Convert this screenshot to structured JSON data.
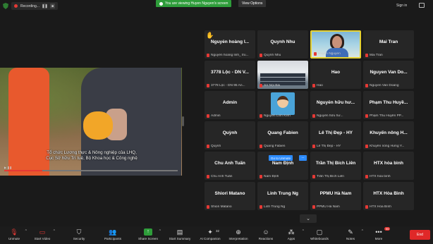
{
  "topbar": {
    "recording_label": "Recording...",
    "viewing_label": "You are viewing Huyen Nguyen's screen",
    "view_options_label": "View Options",
    "signin_label": "Sign in"
  },
  "share": {
    "subtitle_line1": "Tổ chức Lương thực & Nông nghiệp của LHQ,",
    "subtitle_line2": "Cục Sở hữu Trí tuệ, Bộ Khoa học & Công nghệ",
    "progress_fraction": 0.22
  },
  "participants": [
    {
      "name": "Nguyễn hoàng l...",
      "label": "Nguyễn hoàng linh_ tru...",
      "hand": true
    },
    {
      "name": "Quynh Nhu",
      "label": "Quỳnh Nhu"
    },
    {
      "name": "",
      "label": "Huyen Nguyen",
      "picture": "speaker",
      "active": true
    },
    {
      "name": "Mai Tran",
      "label": "Mai Tran"
    },
    {
      "name": "3778 Lộc - DN V...",
      "label": "3778 Lộc - DN 95 An..."
    },
    {
      "name": "",
      "label": "Sở Nội Bài",
      "picture": "room"
    },
    {
      "name": "Hao",
      "label": "Hao"
    },
    {
      "name": "Nguyen Van Do...",
      "label": "Nguyen Van Doang"
    },
    {
      "name": "Admin",
      "label": "Admin"
    },
    {
      "name": "",
      "label": "Nguyễn Linh Kinh",
      "picture": "avatar"
    },
    {
      "name": "Nguyễn hữu hư...",
      "label": "Nguyễn hữu hư..."
    },
    {
      "name": "Phạm Thu Huyề...",
      "label": "Phạm Thu Huyền PP..."
    },
    {
      "name": "Quỳnh",
      "label": "Quỳnh"
    },
    {
      "name": "Quang Fabien",
      "label": "Quang Fabien"
    },
    {
      "name": "Lê Thị Đẹp - HY",
      "label": "Lê Thị Đẹp - HY"
    },
    {
      "name": "Khuyến nông H...",
      "label": "Khuyến nông Hưng Y..."
    },
    {
      "name": "Chu Anh Tuấn",
      "label": "Chu Anh Tuấn"
    },
    {
      "name": "Nam Định",
      "label": "Nam Định"
    },
    {
      "name": "Trần Thị Bích Liên",
      "label": "Trần Thị Bích Liên"
    },
    {
      "name": "HTX hòa bình",
      "label": "HTX hòa bình"
    },
    {
      "name": "Shiori Matano",
      "label": "Shiori Matano"
    },
    {
      "name": "Linh Trung Ng",
      "label": "Linh Trung Ng"
    },
    {
      "name": "PPMU Hà Nam",
      "label": "PPMU Hà Nam"
    },
    {
      "name": "HTX Hòa Bình",
      "label": "HTX Hòa Bình"
    }
  ],
  "unmute_prompt": "Go to Unmute",
  "more_dots": "...",
  "toolbar": {
    "unmute": "Unmute",
    "start_video": "Start Video",
    "security": "Security",
    "participants": "Participants",
    "participants_count": "32",
    "share_screen": "Share Screen",
    "start_summary": "Start Summary",
    "ai_companion": "AI Companion",
    "interpretation": "Interpretation",
    "reactions": "Reactions",
    "apps": "Apps",
    "whiteboards": "Whiteboards",
    "notes": "Notes",
    "more": "More",
    "more_badge": "95",
    "end": "End"
  }
}
